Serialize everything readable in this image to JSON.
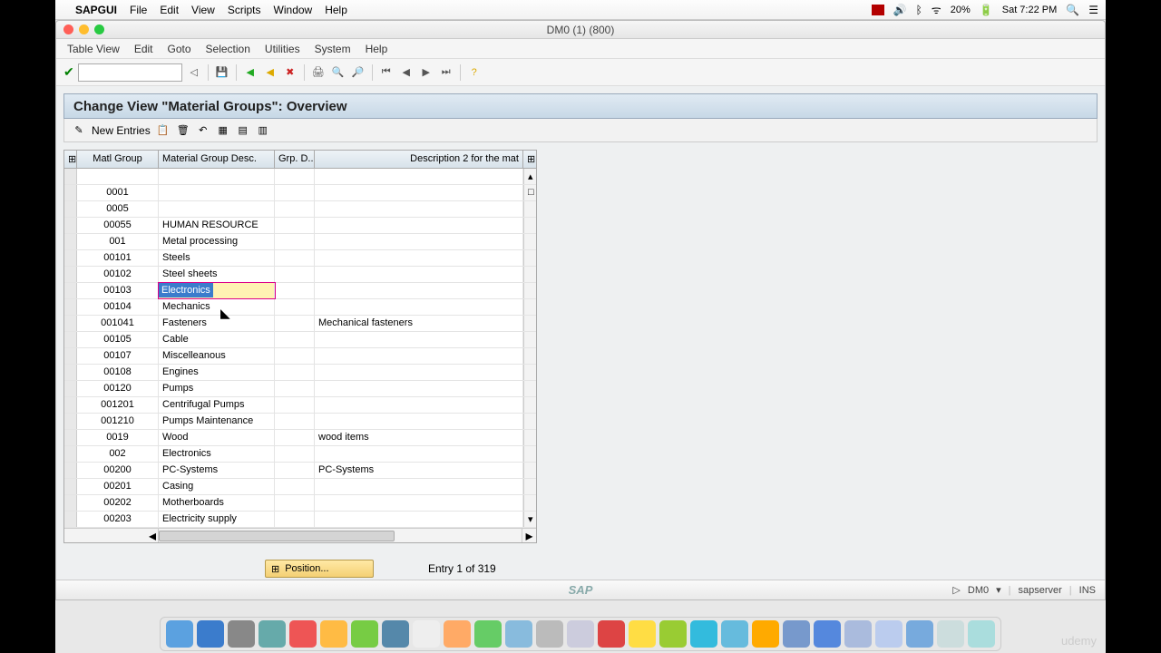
{
  "mac": {
    "app": "SAPGUI",
    "menus": [
      "File",
      "Edit",
      "View",
      "Scripts",
      "Window",
      "Help"
    ],
    "battery": "20%",
    "clock": "Sat 7:22 PM"
  },
  "window": {
    "title": "DM0 (1) (800)"
  },
  "sap_menu": [
    "Table View",
    "Edit",
    "Goto",
    "Selection",
    "Utilities",
    "System",
    "Help"
  ],
  "view_title": "Change View \"Material Groups\": Overview",
  "new_entries": "New Entries",
  "columns": {
    "sel": "",
    "grp": "Matl Group",
    "desc": "Material Group Desc.",
    "gd": "Grp. D...",
    "d2": "Description 2 for the mat"
  },
  "rows": [
    {
      "grp": "",
      "desc": "",
      "d2": ""
    },
    {
      "grp": "0001",
      "desc": "",
      "d2": ""
    },
    {
      "grp": "0005",
      "desc": "",
      "d2": ""
    },
    {
      "grp": "00055",
      "desc": "HUMAN RESOURCE",
      "d2": ""
    },
    {
      "grp": "001",
      "desc": "Metal processing",
      "d2": ""
    },
    {
      "grp": "00101",
      "desc": "Steels",
      "d2": ""
    },
    {
      "grp": "00102",
      "desc": "Steel sheets",
      "d2": ""
    },
    {
      "grp": "00103",
      "desc": "Electronics",
      "d2": "",
      "editing": true
    },
    {
      "grp": "00104",
      "desc": "Mechanics",
      "d2": ""
    },
    {
      "grp": "001041",
      "desc": "Fasteners",
      "d2": "Mechanical fasteners"
    },
    {
      "grp": "00105",
      "desc": "Cable",
      "d2": ""
    },
    {
      "grp": "00107",
      "desc": "Miscelleanous",
      "d2": ""
    },
    {
      "grp": "00108",
      "desc": "Engines",
      "d2": ""
    },
    {
      "grp": "00120",
      "desc": "Pumps",
      "d2": ""
    },
    {
      "grp": "001201",
      "desc": "Centrifugal Pumps",
      "d2": ""
    },
    {
      "grp": "001210",
      "desc": "Pumps Maintenance",
      "d2": ""
    },
    {
      "grp": "0019",
      "desc": "Wood",
      "d2": "wood items"
    },
    {
      "grp": "002",
      "desc": "Electronics",
      "d2": ""
    },
    {
      "grp": "00200",
      "desc": "PC-Systems",
      "d2": "PC-Systems"
    },
    {
      "grp": "00201",
      "desc": "Casing",
      "d2": ""
    },
    {
      "grp": "00202",
      "desc": "Motherboards",
      "d2": ""
    },
    {
      "grp": "00203",
      "desc": "Electricity supply",
      "d2": ""
    }
  ],
  "position_btn": "Position...",
  "entry_status": "Entry 1 of 319",
  "status": {
    "system": "DM0",
    "server": "sapserver",
    "mode": "INS"
  },
  "sap_logo": "SAP",
  "dock_colors": [
    "#5ba1e0",
    "#3b7ccc",
    "#888",
    "#6aa",
    "#e55",
    "#fb4",
    "#7c4",
    "#58a",
    "#eee",
    "#fa6",
    "#6c6",
    "#8bd",
    "#bbb",
    "#ccd",
    "#d44",
    "#fd4",
    "#9c3",
    "#3bd",
    "#6bd",
    "#fa0",
    "#79c",
    "#58d",
    "#abd",
    "#bce",
    "#7ad",
    "#cdd",
    "#add"
  ],
  "udemy": "udemy"
}
